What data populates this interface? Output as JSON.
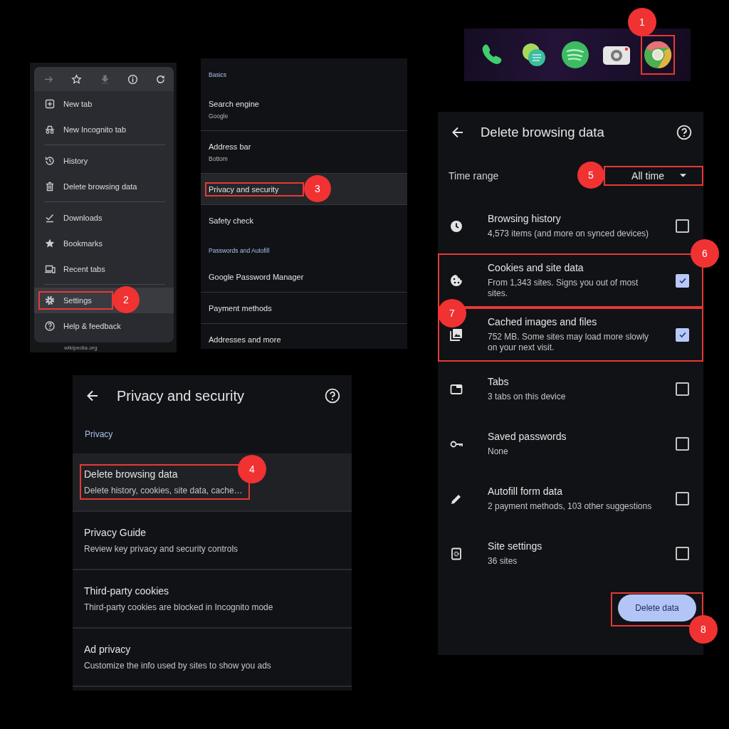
{
  "dock": {
    "highlighted": true,
    "step": "1"
  },
  "menu": {
    "groups": [
      [
        {
          "label": "New tab",
          "highlighted": false
        },
        {
          "label": "New Incognito tab",
          "highlighted": false
        }
      ],
      [
        {
          "label": "History",
          "highlighted": false
        },
        {
          "label": "Delete browsing data",
          "highlighted": false
        }
      ],
      [
        {
          "label": "Downloads",
          "highlighted": false
        },
        {
          "label": "Bookmarks",
          "highlighted": false
        },
        {
          "label": "Recent tabs",
          "highlighted": false
        }
      ],
      [
        {
          "label": "Settings",
          "highlighted": true,
          "step": "2"
        },
        {
          "label": "Help & feedback",
          "highlighted": false
        }
      ]
    ],
    "backdrop_text": "wikipedia.org"
  },
  "settings": {
    "sections": [
      {
        "heading": "Basics",
        "items": [
          {
            "title": "Search engine",
            "subtitle": "Google",
            "highlighted": false
          },
          {
            "title": "Address bar",
            "subtitle": "Bottom",
            "highlighted": false
          },
          {
            "title": "Privacy and security",
            "highlighted": true,
            "step": "3"
          },
          {
            "title": "Safety check",
            "highlighted": false
          }
        ]
      },
      {
        "heading": "Passwords and Autofill",
        "items": [
          {
            "title": "Google Password Manager",
            "highlighted": false
          },
          {
            "title": "Payment methods",
            "highlighted": false
          },
          {
            "title": "Addresses and more",
            "highlighted": false
          }
        ]
      }
    ]
  },
  "privacy": {
    "title": "Privacy and security",
    "heading": "Privacy",
    "items": [
      {
        "title": "Delete browsing data",
        "subtitle": "Delete history, cookies, site data, cache…",
        "highlighted": true,
        "step": "4"
      },
      {
        "title": "Privacy Guide",
        "subtitle": "Review key privacy and security controls",
        "highlighted": false
      },
      {
        "title": "Third-party cookies",
        "subtitle": "Third-party cookies are blocked in Incognito mode",
        "highlighted": false
      },
      {
        "title": "Ad privacy",
        "subtitle": "Customize the info used by sites to show you ads",
        "highlighted": false
      }
    ]
  },
  "delete_data": {
    "title": "Delete browsing data",
    "time_range": {
      "label": "Time range",
      "value": "All time",
      "highlighted": true,
      "step": "5"
    },
    "items": [
      {
        "title": "Browsing history",
        "subtitle": "4,573 items (and more on synced devices)",
        "checked": false,
        "highlighted": false
      },
      {
        "title": "Cookies and site data",
        "subtitle": "From 1,343 sites. Signs you out of most sites.",
        "checked": true,
        "highlighted": true,
        "step": "6"
      },
      {
        "title": "Cached images and files",
        "subtitle": "752 MB. Some sites may load more slowly on your next visit.",
        "checked": true,
        "highlighted": true,
        "step": "7"
      },
      {
        "title": "Tabs",
        "subtitle": "3 tabs on this device",
        "checked": false,
        "highlighted": false
      },
      {
        "title": "Saved passwords",
        "subtitle": "None",
        "checked": false,
        "highlighted": false
      },
      {
        "title": "Autofill form data",
        "subtitle": "2 payment methods, 103 other suggestions",
        "checked": false,
        "highlighted": false
      },
      {
        "title": "Site settings",
        "subtitle": "36 sites",
        "checked": false,
        "highlighted": false
      }
    ],
    "button": {
      "label": "Delete data",
      "highlighted": true,
      "step": "8"
    }
  }
}
